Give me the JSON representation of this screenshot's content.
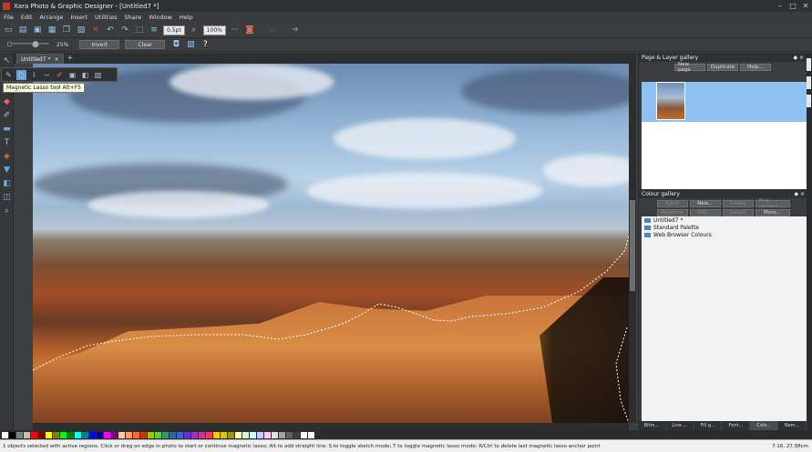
{
  "window": {
    "title": "Xara Photo & Graphic Designer - [Untitled7 *]"
  },
  "menu": [
    "File",
    "Edit",
    "Arrange",
    "Insert",
    "Utilities",
    "Share",
    "Window",
    "Help"
  ],
  "toolbar1": {
    "line_width": "0.5pt",
    "zoom": "100%"
  },
  "toolbar2": {
    "slider_value": "25%",
    "invert_label": "Invert",
    "clear_label": "Clear"
  },
  "document_tab": {
    "label": "Untitled7 *",
    "add": "+"
  },
  "tooltip": "Magnetic Lasso tool  Alt+F5",
  "page_gallery": {
    "title": "Page & Layer gallery",
    "new_page": "New page",
    "duplicate": "Duplicate",
    "help": "Help..."
  },
  "colour_gallery": {
    "title": "Colour gallery",
    "buttons": [
      "Apply",
      "New...",
      "Create",
      "Find unused",
      "Redefine",
      "Edit...",
      "Delete",
      "More..."
    ],
    "disabled": [
      true,
      false,
      true,
      true,
      true,
      true,
      true,
      false
    ],
    "items": [
      "Untitled7 *",
      "Standard Palette",
      "Web Browser Colours"
    ]
  },
  "bottom_tabs": [
    "Bitm...",
    "Line ...",
    "Fill g...",
    "Font...",
    "Colo...",
    "Nam..."
  ],
  "palette_colors": [
    "#ffffff",
    "#000000",
    "#7f7f7f",
    "#c0c0c0",
    "#ff0000",
    "#800000",
    "#ffff00",
    "#808000",
    "#00ff00",
    "#008000",
    "#00ffff",
    "#008080",
    "#0000ff",
    "#000080",
    "#ff00ff",
    "#800080",
    "#ffcc99",
    "#ff9966",
    "#ff6633",
    "#cc3300",
    "#99cc00",
    "#66cc33",
    "#339966",
    "#336699",
    "#3366cc",
    "#6633cc",
    "#9933cc",
    "#cc3399",
    "#ff3366",
    "#ffcc00",
    "#cccc00",
    "#999900",
    "#ffffcc",
    "#ccffcc",
    "#ccffff",
    "#ccccff",
    "#ffccff",
    "#e0e0e0",
    "#a0a0a0",
    "#606060",
    "#404040",
    "#ffffff",
    "#ffffff"
  ],
  "status": {
    "text": "1 objects selected with active regions. Click or drag on edge in photo to start or continue magnetic lasso; Alt to add straight line; S to toggle sketch mode; T to toggle magnetic lasso mode; R/Ctrl to delete last magnetic lasso anchor point",
    "clock": "7:16, 27.98cm"
  }
}
